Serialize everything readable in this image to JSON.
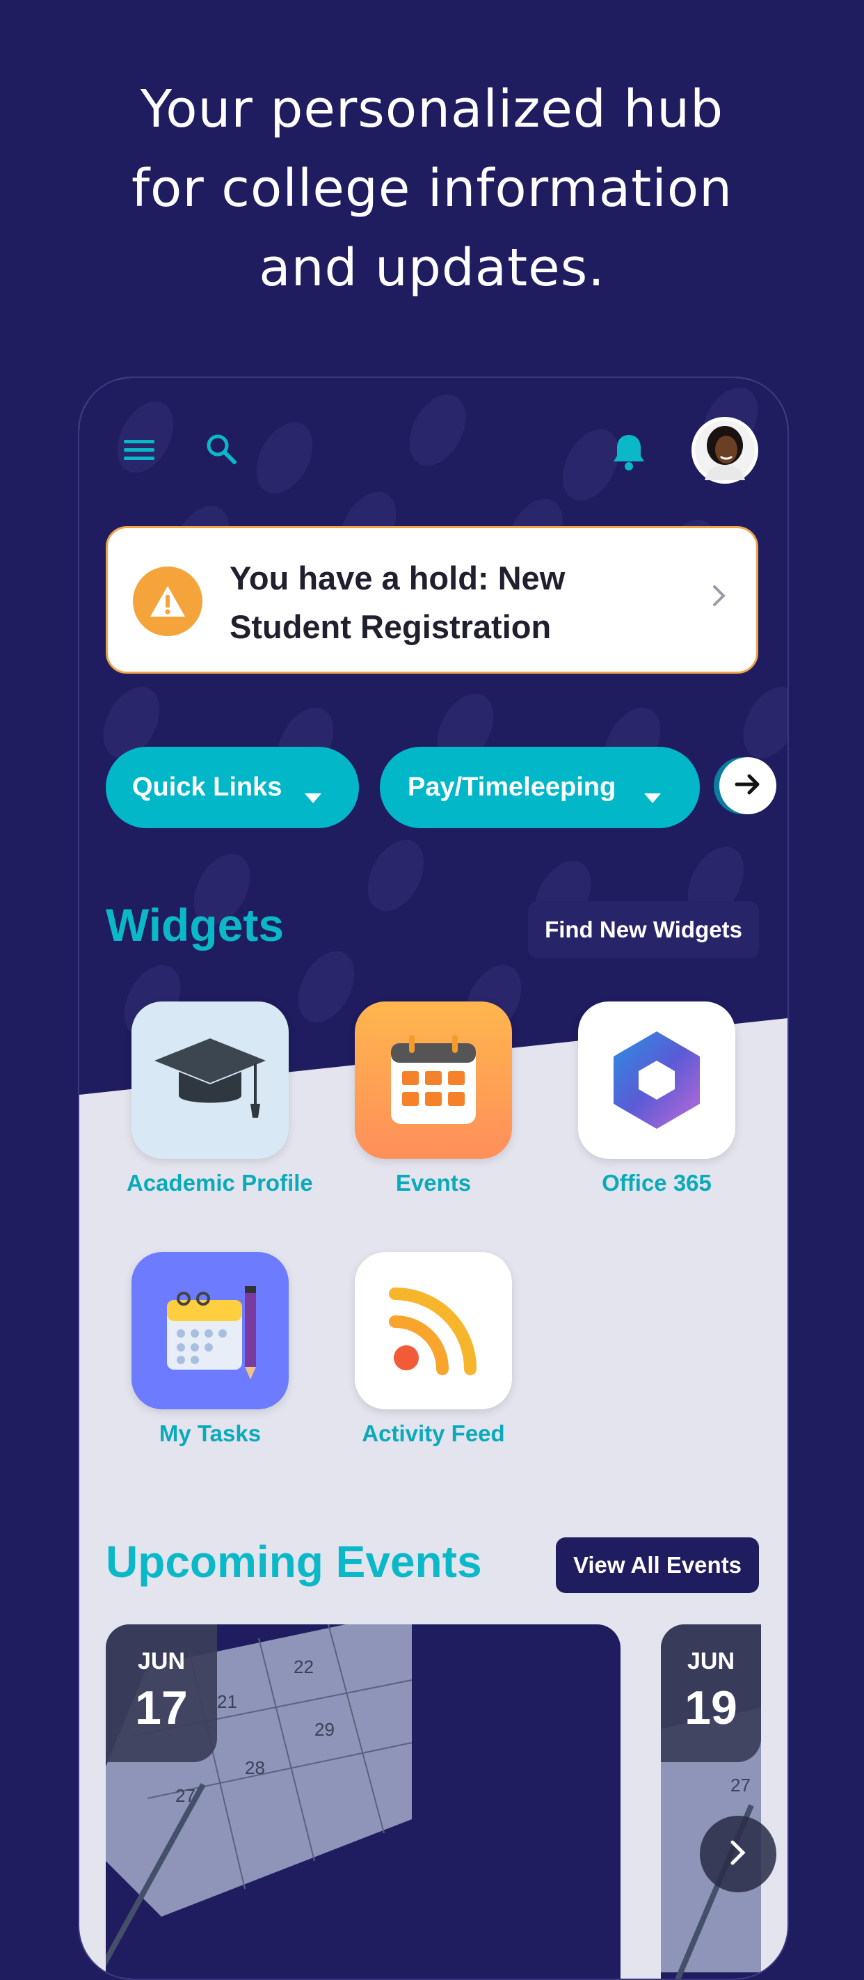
{
  "headline": [
    "Your personalized hub",
    "for college information",
    "and updates."
  ],
  "top_bar": {
    "menu_icon": "hamburger-menu-icon",
    "search_icon": "search-icon",
    "notification_icon": "bell-icon",
    "avatar_icon": "user-avatar"
  },
  "hold_alert": {
    "icon": "warning-icon",
    "lines": [
      "You have a hold: New",
      "Student Registration"
    ],
    "chevron": "chevron-right-icon",
    "accent": "#f4a43b"
  },
  "quick_pills": [
    {
      "label": "Quick Links",
      "icon": "caret-down-icon"
    },
    {
      "label": "Pay/Timeleeping",
      "icon": "caret-down-icon"
    }
  ],
  "scroll_next_icon": "arrow-right-icon",
  "widgets_section": {
    "title": "Widgets",
    "find_button": "Find New Widgets",
    "items": [
      {
        "label": "Academic Profile",
        "icon": "graduation-cap-icon"
      },
      {
        "label": "Events",
        "icon": "calendar-icon"
      },
      {
        "label": "Office 365",
        "icon": "office-365-icon"
      },
      {
        "label": "My Tasks",
        "icon": "tasks-icon"
      },
      {
        "label": "Activity Feed",
        "icon": "rss-feed-icon"
      }
    ]
  },
  "events_section": {
    "title": "Upcoming Events",
    "view_all_button": "View All Events",
    "events": [
      {
        "month": "JUN",
        "day": "17"
      },
      {
        "month": "JUN",
        "day": "19"
      }
    ]
  },
  "colors": {
    "background": "#1f1c5f",
    "accent": "#02b7c8",
    "warning": "#f4a43b"
  }
}
